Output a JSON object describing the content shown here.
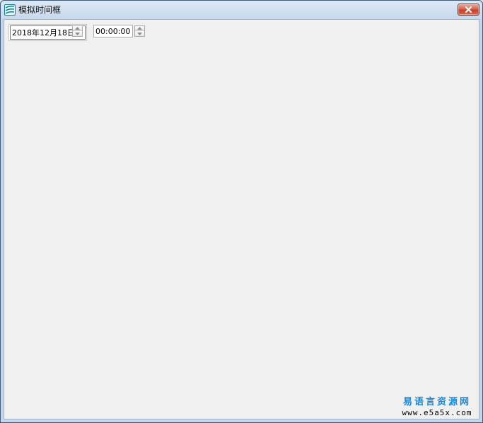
{
  "window": {
    "title": "模拟时间框",
    "icon": "app-logo-icon",
    "close_icon": "close-icon"
  },
  "date_picker": {
    "value": "2018年12月18日",
    "spinner_icons": [
      "spin-up-icon",
      "spin-down-icon"
    ]
  },
  "time_picker": {
    "value": "00:00:00",
    "spinner_icons": [
      "spin-up-icon",
      "spin-down-icon"
    ]
  },
  "watermark": {
    "title": "易语言资源网",
    "url": "www.e5a5x.com",
    "color": "#1a86d6"
  },
  "colors": {
    "client_background": "#f0f0f0",
    "close_button": "#c5402e",
    "title_bar": "#dce8f5"
  }
}
